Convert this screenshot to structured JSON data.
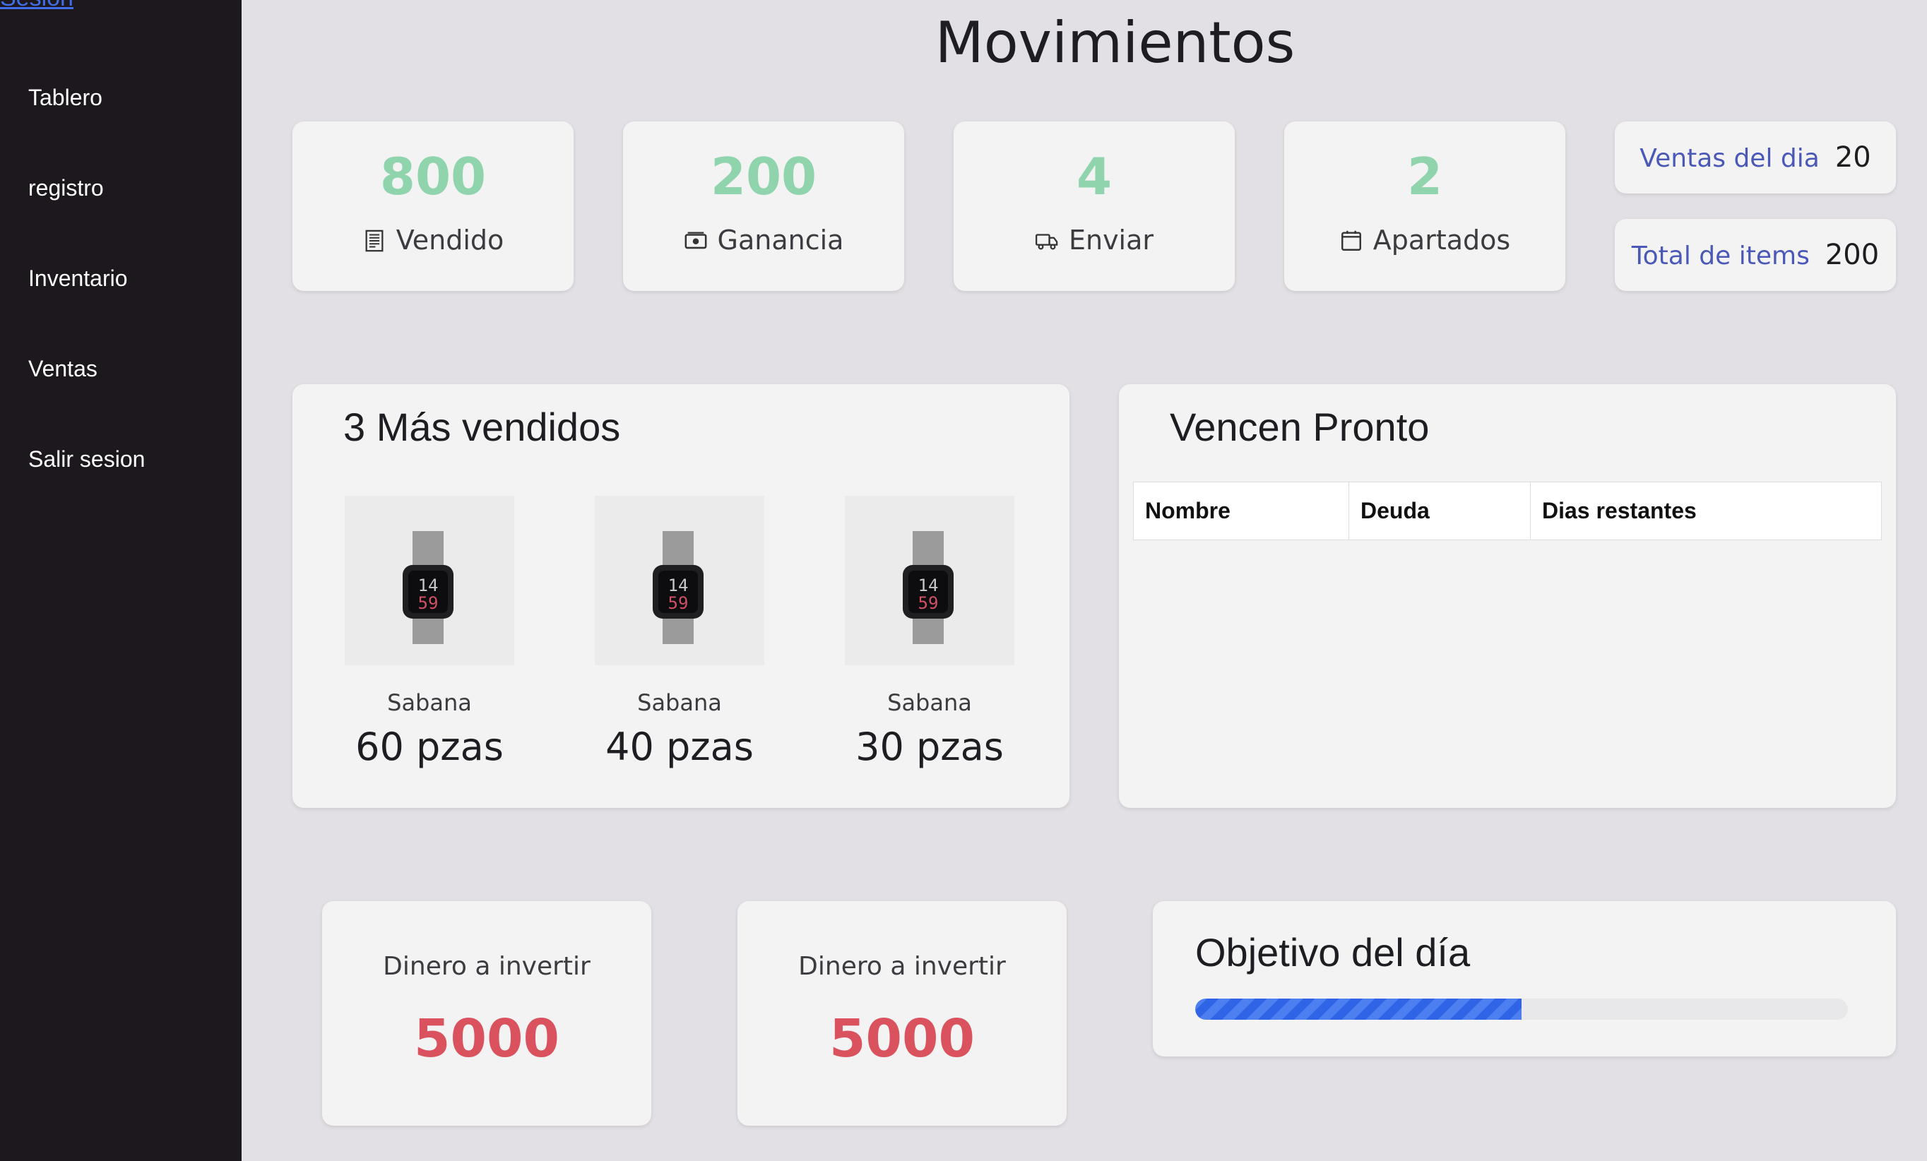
{
  "sidebar": {
    "cut_link": "Sesion",
    "items": [
      {
        "label": "Tablero"
      },
      {
        "label": "registro"
      },
      {
        "label": "Inventario"
      },
      {
        "label": "Ventas"
      },
      {
        "label": "Salir sesion"
      }
    ]
  },
  "page": {
    "title": "Movimientos"
  },
  "stats": [
    {
      "value": "800",
      "label": "Vendido",
      "icon": "receipt-icon"
    },
    {
      "value": "200",
      "label": "Ganancia",
      "icon": "cash-icon"
    },
    {
      "value": "4",
      "label": "Enviar",
      "icon": "truck-icon"
    },
    {
      "value": "2",
      "label": "Apartados",
      "icon": "calendar-icon"
    }
  ],
  "mini_stats": [
    {
      "label": "Ventas del dia",
      "value": "20"
    },
    {
      "label": "Total de items",
      "value": "200"
    }
  ],
  "top_sellers": {
    "title": "3 Más vendidos",
    "items": [
      {
        "name": "Sabana",
        "qty": "60 pzas"
      },
      {
        "name": "Sabana",
        "qty": "40 pzas"
      },
      {
        "name": "Sabana",
        "qty": "30 pzas"
      }
    ]
  },
  "due_soon": {
    "title": "Vencen Pronto",
    "columns": [
      "Nombre",
      "Deuda",
      "Dias restantes"
    ]
  },
  "money": [
    {
      "label": "Dinero a invertir",
      "value": "5000"
    },
    {
      "label": "Dinero a invertir",
      "value": "5000"
    }
  ],
  "goal": {
    "title": "Objetivo del día",
    "progress": 0.5
  },
  "colors": {
    "accent_green": "#8fd4ad",
    "accent_red": "#d9525e",
    "link_blue": "#4a59b8",
    "progress_blue": "#3a6fea"
  }
}
